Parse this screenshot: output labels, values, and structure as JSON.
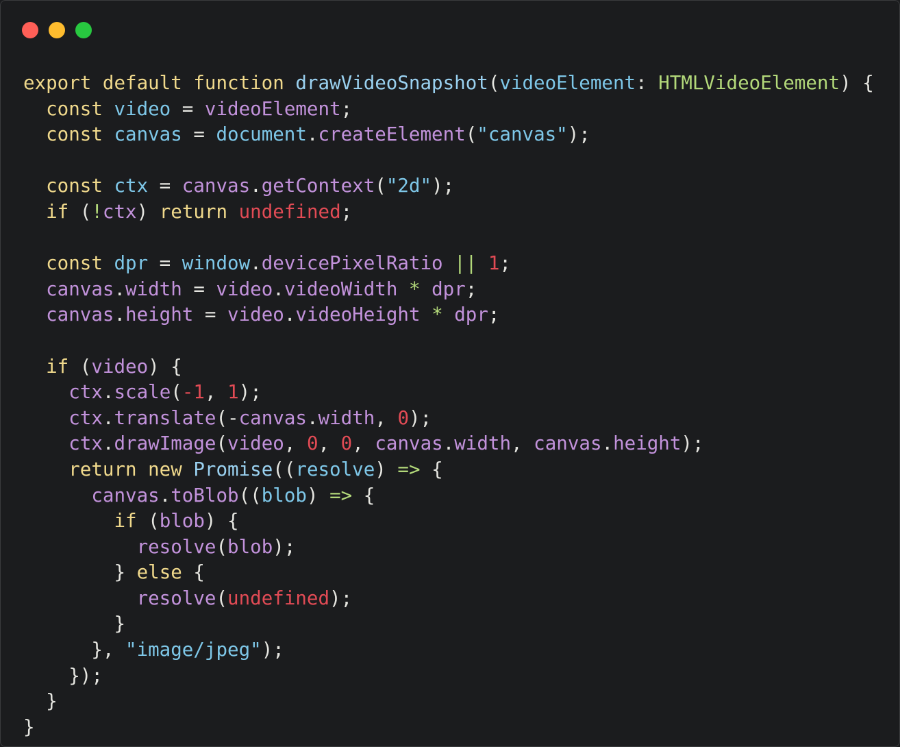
{
  "window": {
    "controls": [
      {
        "name": "close",
        "color": "#ff5f57"
      },
      {
        "name": "minimize",
        "color": "#febc2e"
      },
      {
        "name": "zoom",
        "color": "#28c840"
      }
    ]
  },
  "theme": {
    "background": "#1b1c1e",
    "keyword": "#f0d98c",
    "function": "#9ad1f0",
    "type": "#b3d97a",
    "identifier": "#c292db",
    "number": "#e24b55",
    "string": "#7ec7e8",
    "operator": "#b3d97a",
    "punctuation": "#e5e5e0",
    "parameter": "#7ec7e8"
  },
  "code": {
    "language": "typescript",
    "lines": [
      [
        [
          "export default function ",
          "kw"
        ],
        [
          "drawVideoSnapshot",
          "fn"
        ],
        [
          "(",
          "p"
        ],
        [
          "videoElement",
          "param"
        ],
        [
          ": ",
          "p"
        ],
        [
          "HTMLVideoElement",
          "type"
        ],
        [
          ") {",
          "p"
        ]
      ],
      [
        [
          "  const ",
          "kw"
        ],
        [
          "video",
          "param"
        ],
        [
          " = ",
          "p"
        ],
        [
          "videoElement",
          "id"
        ],
        [
          ";",
          "p"
        ]
      ],
      [
        [
          "  const ",
          "kw"
        ],
        [
          "canvas",
          "param"
        ],
        [
          " = ",
          "p"
        ],
        [
          "document",
          "param"
        ],
        [
          ".",
          "p"
        ],
        [
          "createElement",
          "id"
        ],
        [
          "(",
          "p"
        ],
        [
          "\"canvas\"",
          "str"
        ],
        [
          ");",
          "p"
        ]
      ],
      [],
      [
        [
          "  const ",
          "kw"
        ],
        [
          "ctx",
          "param"
        ],
        [
          " = ",
          "p"
        ],
        [
          "canvas",
          "id"
        ],
        [
          ".",
          "p"
        ],
        [
          "getContext",
          "id"
        ],
        [
          "(",
          "p"
        ],
        [
          "\"2d\"",
          "str"
        ],
        [
          ");",
          "p"
        ]
      ],
      [
        [
          "  if ",
          "kw"
        ],
        [
          "(",
          "p"
        ],
        [
          "!",
          "op"
        ],
        [
          "ctx",
          "id"
        ],
        [
          ") ",
          "p"
        ],
        [
          "return ",
          "kw"
        ],
        [
          "undefined",
          "num"
        ],
        [
          ";",
          "p"
        ]
      ],
      [],
      [
        [
          "  const ",
          "kw"
        ],
        [
          "dpr",
          "param"
        ],
        [
          " = ",
          "p"
        ],
        [
          "window",
          "param"
        ],
        [
          ".",
          "p"
        ],
        [
          "devicePixelRatio",
          "id"
        ],
        [
          " ",
          "p"
        ],
        [
          "||",
          "op"
        ],
        [
          " ",
          "p"
        ],
        [
          "1",
          "num"
        ],
        [
          ";",
          "p"
        ]
      ],
      [
        [
          "  canvas",
          "id"
        ],
        [
          ".",
          "p"
        ],
        [
          "width",
          "id"
        ],
        [
          " = ",
          "p"
        ],
        [
          "video",
          "id"
        ],
        [
          ".",
          "p"
        ],
        [
          "videoWidth",
          "id"
        ],
        [
          " ",
          "p"
        ],
        [
          "*",
          "op"
        ],
        [
          " ",
          "p"
        ],
        [
          "dpr",
          "id"
        ],
        [
          ";",
          "p"
        ]
      ],
      [
        [
          "  canvas",
          "id"
        ],
        [
          ".",
          "p"
        ],
        [
          "height",
          "id"
        ],
        [
          " = ",
          "p"
        ],
        [
          "video",
          "id"
        ],
        [
          ".",
          "p"
        ],
        [
          "videoHeight",
          "id"
        ],
        [
          " ",
          "p"
        ],
        [
          "*",
          "op"
        ],
        [
          " ",
          "p"
        ],
        [
          "dpr",
          "id"
        ],
        [
          ";",
          "p"
        ]
      ],
      [],
      [
        [
          "  if ",
          "kw"
        ],
        [
          "(",
          "p"
        ],
        [
          "video",
          "id"
        ],
        [
          ") {",
          "p"
        ]
      ],
      [
        [
          "    ctx",
          "id"
        ],
        [
          ".",
          "p"
        ],
        [
          "scale",
          "id"
        ],
        [
          "(",
          "p"
        ],
        [
          "-1",
          "num"
        ],
        [
          ", ",
          "p"
        ],
        [
          "1",
          "num"
        ],
        [
          ");",
          "p"
        ]
      ],
      [
        [
          "    ctx",
          "id"
        ],
        [
          ".",
          "p"
        ],
        [
          "translate",
          "id"
        ],
        [
          "(-",
          "p"
        ],
        [
          "canvas",
          "id"
        ],
        [
          ".",
          "p"
        ],
        [
          "width",
          "id"
        ],
        [
          ", ",
          "p"
        ],
        [
          "0",
          "num"
        ],
        [
          ");",
          "p"
        ]
      ],
      [
        [
          "    ctx",
          "id"
        ],
        [
          ".",
          "p"
        ],
        [
          "drawImage",
          "id"
        ],
        [
          "(",
          "p"
        ],
        [
          "video",
          "id"
        ],
        [
          ", ",
          "p"
        ],
        [
          "0",
          "num"
        ],
        [
          ", ",
          "p"
        ],
        [
          "0",
          "num"
        ],
        [
          ", ",
          "p"
        ],
        [
          "canvas",
          "id"
        ],
        [
          ".",
          "p"
        ],
        [
          "width",
          "id"
        ],
        [
          ", ",
          "p"
        ],
        [
          "canvas",
          "id"
        ],
        [
          ".",
          "p"
        ],
        [
          "height",
          "id"
        ],
        [
          ");",
          "p"
        ]
      ],
      [
        [
          "    return new ",
          "kw"
        ],
        [
          "Promise",
          "fn"
        ],
        [
          "((",
          "p"
        ],
        [
          "resolve",
          "param"
        ],
        [
          ") ",
          "p"
        ],
        [
          "=>",
          "op"
        ],
        [
          " {",
          "p"
        ]
      ],
      [
        [
          "      canvas",
          "id"
        ],
        [
          ".",
          "p"
        ],
        [
          "toBlob",
          "id"
        ],
        [
          "((",
          "p"
        ],
        [
          "blob",
          "param"
        ],
        [
          ") ",
          "p"
        ],
        [
          "=>",
          "op"
        ],
        [
          " {",
          "p"
        ]
      ],
      [
        [
          "        if ",
          "kw"
        ],
        [
          "(",
          "p"
        ],
        [
          "blob",
          "id"
        ],
        [
          ") {",
          "p"
        ]
      ],
      [
        [
          "          resolve",
          "id"
        ],
        [
          "(",
          "p"
        ],
        [
          "blob",
          "id"
        ],
        [
          ");",
          "p"
        ]
      ],
      [
        [
          "        } ",
          "p"
        ],
        [
          "else",
          "kw"
        ],
        [
          " {",
          "p"
        ]
      ],
      [
        [
          "          resolve",
          "id"
        ],
        [
          "(",
          "p"
        ],
        [
          "undefined",
          "num"
        ],
        [
          ");",
          "p"
        ]
      ],
      [
        [
          "        }",
          "p"
        ]
      ],
      [
        [
          "      }, ",
          "p"
        ],
        [
          "\"image/jpeg\"",
          "str"
        ],
        [
          ");",
          "p"
        ]
      ],
      [
        [
          "    });",
          "p"
        ]
      ],
      [
        [
          "  }",
          "p"
        ]
      ],
      [
        [
          "}",
          "p"
        ]
      ]
    ]
  }
}
